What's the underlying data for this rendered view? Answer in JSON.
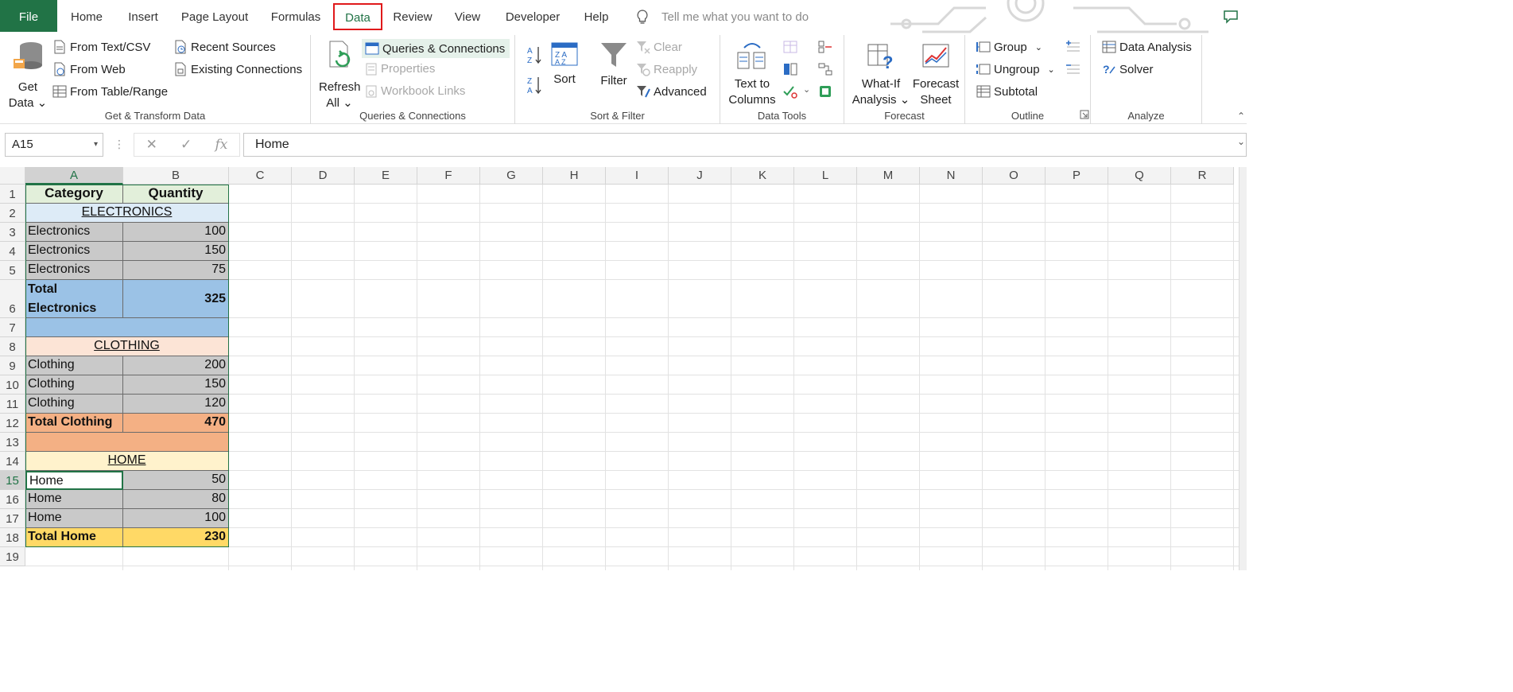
{
  "tabs": {
    "file": "File",
    "home": "Home",
    "insert": "Insert",
    "page_layout": "Page Layout",
    "formulas": "Formulas",
    "data": "Data",
    "review": "Review",
    "view": "View",
    "developer": "Developer",
    "help": "Help",
    "tell_me": "Tell me what you want to do"
  },
  "ribbon": {
    "get_transform": {
      "get_data_l1": "Get",
      "get_data_l2": "Data",
      "from_text_csv": "From Text/CSV",
      "from_web": "From Web",
      "from_table_range": "From Table/Range",
      "recent_sources": "Recent Sources",
      "existing_connections": "Existing Connections",
      "label": "Get & Transform Data"
    },
    "queries": {
      "refresh_l1": "Refresh",
      "refresh_l2": "All",
      "queries_connections": "Queries & Connections",
      "properties": "Properties",
      "workbook_links": "Workbook Links",
      "label": "Queries & Connections"
    },
    "sort_filter": {
      "sort": "Sort",
      "filter": "Filter",
      "clear": "Clear",
      "reapply": "Reapply",
      "advanced": "Advanced",
      "label": "Sort & Filter"
    },
    "data_tools": {
      "text_to_l1": "Text to",
      "text_to_l2": "Columns",
      "label": "Data Tools"
    },
    "forecast": {
      "whatif_l1": "What-If",
      "whatif_l2": "Analysis",
      "forecast_l1": "Forecast",
      "forecast_l2": "Sheet",
      "label": "Forecast"
    },
    "outline": {
      "group": "Group",
      "ungroup": "Ungroup",
      "subtotal": "Subtotal",
      "label": "Outline"
    },
    "analyze": {
      "data_analysis": "Data Analysis",
      "solver": "Solver",
      "label": "Analyze"
    }
  },
  "formula_bar": {
    "name_box": "A15",
    "content": "Home"
  },
  "columns": [
    "A",
    "B",
    "C",
    "D",
    "E",
    "F",
    "G",
    "H",
    "I",
    "J",
    "K",
    "L",
    "M",
    "N",
    "O",
    "P",
    "Q",
    "R"
  ],
  "rows": [
    "1",
    "2",
    "3",
    "4",
    "5",
    "6",
    "7",
    "8",
    "9",
    "10",
    "11",
    "12",
    "13",
    "14",
    "15",
    "16",
    "17",
    "18",
    "19"
  ],
  "sheet": {
    "r1": {
      "a": "Category",
      "b": "Quantity"
    },
    "r2": {
      "a": "ELECTRONICS"
    },
    "r3": {
      "a": "Electronics",
      "b": "100"
    },
    "r4": {
      "a": "Electronics",
      "b": "150"
    },
    "r5": {
      "a": "Electronics",
      "b": "75"
    },
    "r6": {
      "a": "Total Electronics",
      "b": "325"
    },
    "r8": {
      "a": "CLOTHING"
    },
    "r9": {
      "a": "Clothing",
      "b": "200"
    },
    "r10": {
      "a": "Clothing",
      "b": "150"
    },
    "r11": {
      "a": "Clothing",
      "b": "120"
    },
    "r12": {
      "a": "Total Clothing",
      "b": "470"
    },
    "r14": {
      "a": "HOME"
    },
    "r15": {
      "a": "Home",
      "b": "50"
    },
    "r16": {
      "a": "Home",
      "b": "80"
    },
    "r17": {
      "a": "Home",
      "b": "100"
    },
    "r18": {
      "a": "Total Home",
      "b": "230"
    }
  },
  "colors": {
    "excel_green": "#217346",
    "header_green": "#e2efda",
    "electronics_light": "#ddebf7",
    "electronics_total": "#9bc2e6",
    "clothing_light": "#fce4d6",
    "clothing_total": "#f4b084",
    "home_light": "#fff2cc",
    "home_total": "#ffd966",
    "gray_cell": "#c9c9c9",
    "highlight_red": "#e0191b"
  }
}
